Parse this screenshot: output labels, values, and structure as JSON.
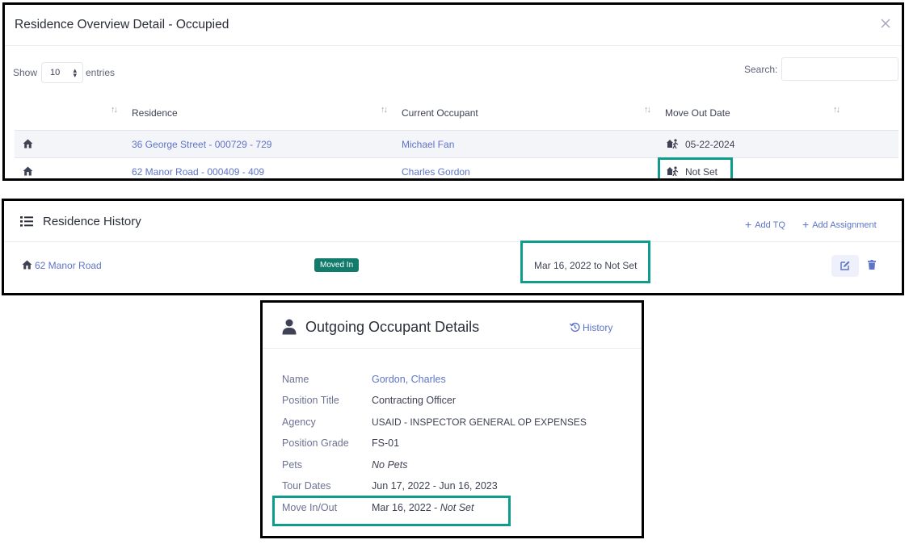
{
  "overview": {
    "title": "Residence Overview Detail - Occupied",
    "show_label": "Show",
    "entries_value": "10",
    "entries_label": "entries",
    "search_label": "Search:",
    "search_value": "",
    "columns": [
      "Residence",
      "Current Occupant",
      "Move Out Date"
    ],
    "rows": [
      {
        "residence": "36 George Street - 000729 - 729",
        "occupant": "Michael Fan",
        "move_out": "05-22-2024"
      },
      {
        "residence": "62 Manor Road - 000409 - 409",
        "occupant": "Charles Gordon",
        "move_out": "Not Set"
      }
    ]
  },
  "history": {
    "title": "Residence History",
    "add_tq": "Add TQ",
    "add_assignment": "Add Assignment",
    "rows": [
      {
        "residence": "62 Manor Road",
        "status": "Moved In",
        "range": "Mar 16, 2022 to Not Set"
      }
    ]
  },
  "occupant": {
    "title": "Outgoing Occupant Details",
    "history_link": "History",
    "fields": [
      {
        "label": "Name",
        "value": "Gordon, Charles"
      },
      {
        "label": "Position Title",
        "value": "Contracting Officer"
      },
      {
        "label": "Agency",
        "value": "USAID - INSPECTOR GENERAL OP EXPENSES"
      },
      {
        "label": "Position Grade",
        "value": "FS-01"
      },
      {
        "label": "Pets",
        "value": "No Pets"
      },
      {
        "label": "Tour Dates",
        "value": "Jun 17, 2022 - Jun 16, 2023"
      },
      {
        "label": "Move In/Out",
        "value": "Mar 16, 2022 -",
        "value_italic": "Not Set"
      }
    ]
  },
  "colors": {
    "link": "#5e74c9",
    "highlight": "#0f9c8c",
    "badge": "#137b6c",
    "text": "#3f4254"
  }
}
